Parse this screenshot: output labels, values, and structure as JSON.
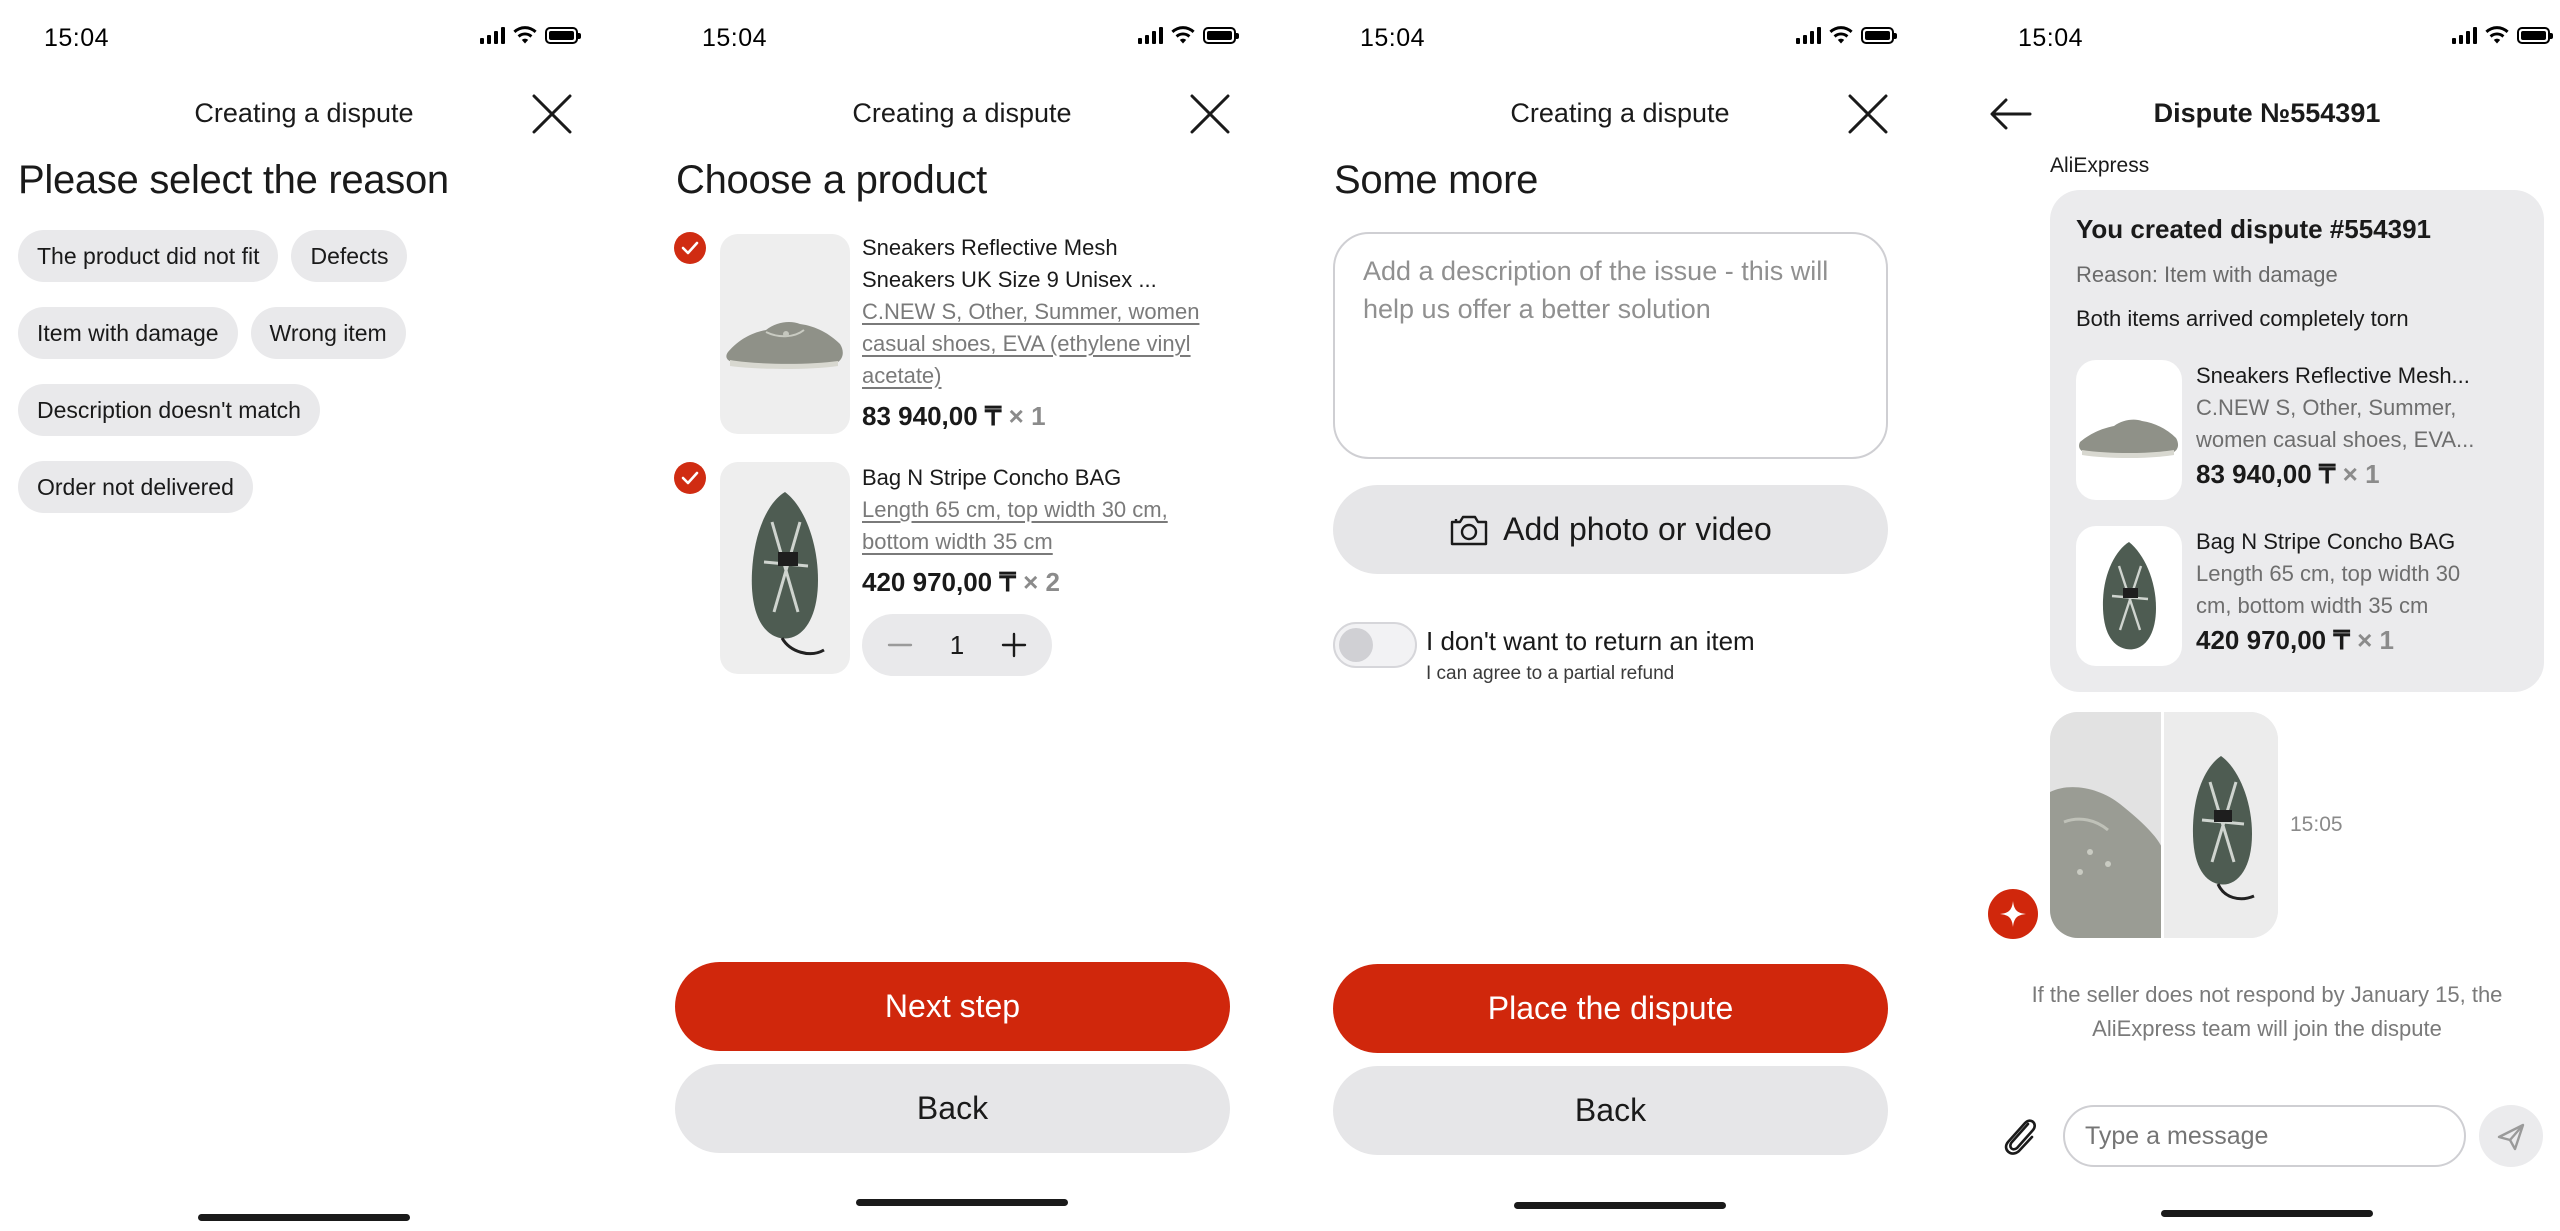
{
  "status_bar": {
    "time": "15:04"
  },
  "screen1": {
    "header_title": "Creating a dispute",
    "heading": "Please select the reason",
    "reasons": [
      [
        "The product did not fit",
        "Defects"
      ],
      [
        "Item with damage",
        "Wrong item"
      ],
      [
        "Description doesn't match"
      ],
      [
        "Order not delivered"
      ]
    ]
  },
  "screen2": {
    "header_title": "Creating a dispute",
    "heading": "Choose a product",
    "products": [
      {
        "title_line1": "Sneakers Reflective Mesh",
        "title_line2": "Sneakers UK Size 9 Unisex ...",
        "variant_line1": "C.NEW S, Other, Summer, women",
        "variant_line2": "casual shoes, EVA (ethylene vinyl",
        "variant_line3": "acetate)",
        "price": "83 940,00 ₸",
        "qty": "× 1",
        "checked": true
      },
      {
        "title_line1": "Bag N Stripe Concho BAG",
        "variant_line1": "Length 65 cm, top width 30 cm,",
        "variant_line2": "bottom width 35 cm",
        "price": "420 970,00 ₸",
        "qty": "× 2",
        "stepper_value": "1",
        "checked": true
      }
    ],
    "next_label": "Next step",
    "back_label": "Back"
  },
  "screen3": {
    "header_title": "Creating a dispute",
    "heading": "Some more",
    "description_placeholder_line1": "Add a description of the issue - this will",
    "description_placeholder_line2": "help us offer a better solution",
    "add_media_label": "Add photo or video",
    "toggle_label": "I don't want to return an item",
    "toggle_sublabel": "I can agree to a partial refund",
    "toggle_on": false,
    "submit_label": "Place the dispute",
    "back_label": "Back"
  },
  "screen4": {
    "header_title": "Dispute №554391",
    "sender": "AliExpress",
    "message": {
      "title": "You created dispute #554391",
      "reason": "Reason: Item with damage",
      "description": "Both items arrived completely torn",
      "items": [
        {
          "title": "Sneakers Reflective Mesh...",
          "variant_line1": "C.NEW S, Other, Summer,",
          "variant_line2": "women casual shoes, EVA...",
          "price": "83 940,00 ₸",
          "qty": "× 1"
        },
        {
          "title": "Bag N Stripe Concho BAG",
          "variant_line1": "Length 65 cm, top width 30",
          "variant_line2": "cm, bottom width 35 cm",
          "price": "420 970,00 ₸",
          "qty": "× 1"
        }
      ]
    },
    "media_time": "15:05",
    "notice_line1": "If the seller does not respond by January 15, the",
    "notice_line2": "AliExpress team will join the dispute",
    "input_placeholder": "Type a message"
  },
  "colors": {
    "accent": "#d0270c",
    "chip_bg": "#e9e9eb",
    "muted_text": "#7a7a7a"
  },
  "icons": [
    "close-icon",
    "back-arrow-icon",
    "camera-icon",
    "paperclip-icon",
    "send-icon",
    "checkbox-checked-icon",
    "minus-icon",
    "plus-icon",
    "sparkle-icon"
  ]
}
